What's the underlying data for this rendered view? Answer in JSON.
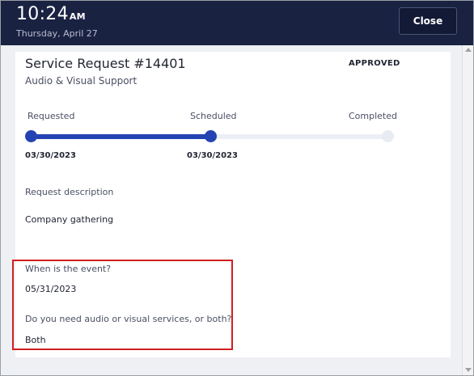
{
  "header": {
    "time": "10:24",
    "ampm": "AM",
    "date": "Thursday, April 27",
    "close_label": "Close"
  },
  "request": {
    "title": "Service Request #14401",
    "subtitle": "Audio & Visual Support",
    "status": "APPROVED"
  },
  "progress": {
    "steps": [
      {
        "label": "Requested",
        "date": "03/30/2023",
        "state": "done"
      },
      {
        "label": "Scheduled",
        "date": "03/30/2023",
        "state": "done"
      },
      {
        "label": "Completed",
        "date": "",
        "state": "todo"
      }
    ],
    "completed_fraction": 0.5
  },
  "details": {
    "description_label": "Request description",
    "description_value": "Company gathering",
    "event_label": "When is the event?",
    "event_value": "05/31/2023",
    "services_label": "Do you need audio or visual services, or both?",
    "services_value": "Both"
  },
  "colors": {
    "header_bg": "#1a2242",
    "accent": "#2443b3",
    "highlight": "#d11f1f"
  },
  "icons": {
    "scroll_up": "chevron-up-icon",
    "scroll_down": "chevron-down-icon"
  }
}
